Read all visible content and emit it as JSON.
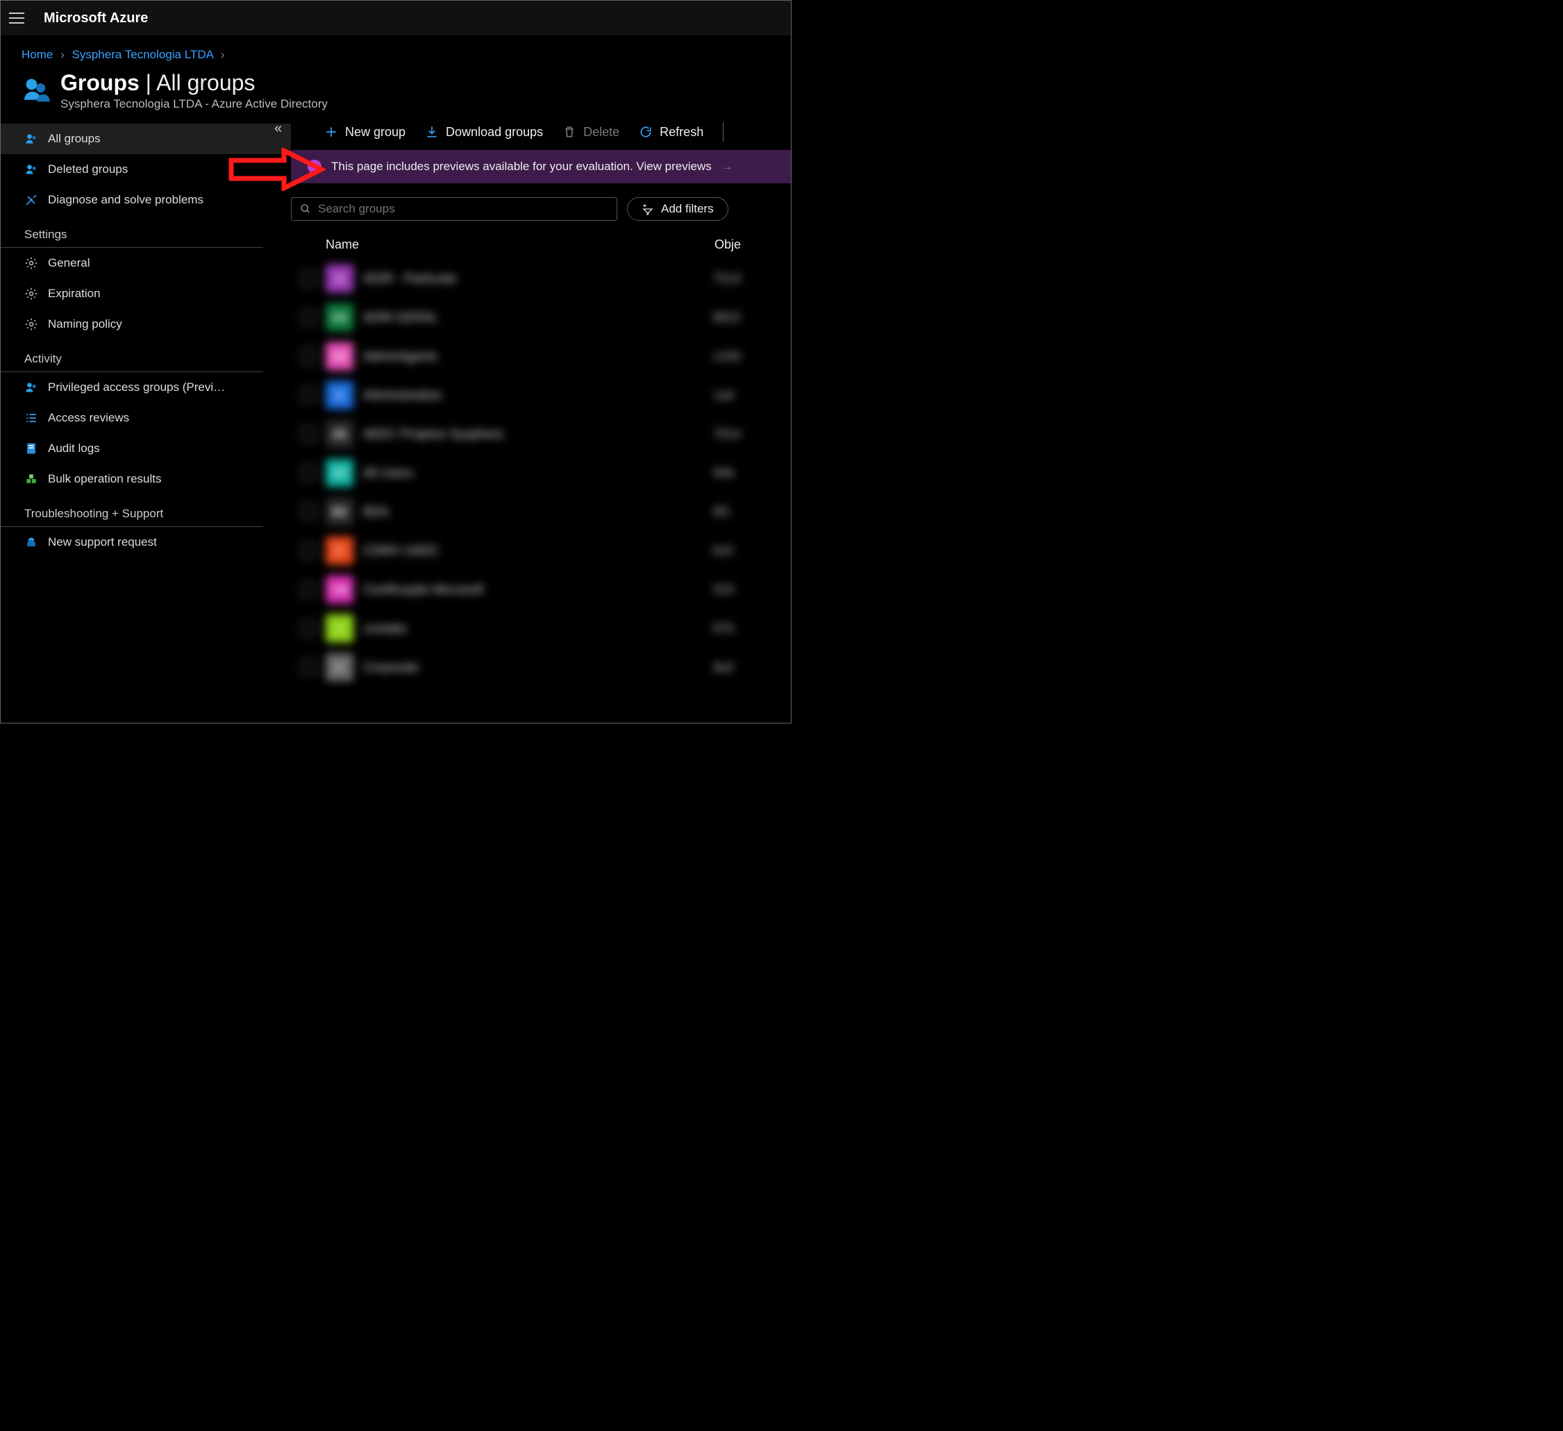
{
  "brand": "Microsoft Azure",
  "breadcrumb": {
    "home": "Home",
    "tenant": "Sysphera Tecnologia LTDA"
  },
  "title": {
    "main": "Groups",
    "section": "All groups",
    "subtitle": "Sysphera Tecnologia LTDA - Azure Active Directory"
  },
  "toolbar": {
    "new_group": "New group",
    "download": "Download groups",
    "delete": "Delete",
    "refresh": "Refresh"
  },
  "banner": {
    "text": "This page includes previews available for your evaluation. View previews"
  },
  "search": {
    "placeholder": "Search groups"
  },
  "filter_btn": "Add filters",
  "columns": {
    "name": "Name",
    "object": "Obje"
  },
  "sidebar": {
    "items": [
      {
        "label": "All groups",
        "icon": "people-icon",
        "active": true
      },
      {
        "label": "Deleted groups",
        "icon": "people-icon"
      },
      {
        "label": "Diagnose and solve problems",
        "icon": "tools-icon"
      }
    ],
    "headers": {
      "settings": "Settings",
      "activity": "Activity",
      "support": "Troubleshooting + Support"
    },
    "settings": [
      {
        "label": "General",
        "icon": "gear-icon"
      },
      {
        "label": "Expiration",
        "icon": "gear-icon"
      },
      {
        "label": "Naming policy",
        "icon": "gear-icon"
      }
    ],
    "activity": [
      {
        "label": "Privileged access groups (Previ…",
        "icon": "people-icon"
      },
      {
        "label": "Access reviews",
        "icon": "checklist-icon"
      },
      {
        "label": "Audit logs",
        "icon": "log-icon"
      },
      {
        "label": "Bulk operation results",
        "icon": "cubes-icon"
      }
    ],
    "support": [
      {
        "label": "New support request",
        "icon": "headset-icon"
      }
    ]
  },
  "rows": [
    {
      "initials": "A",
      "color": "#9b3db5",
      "name": "AD/R - Particular",
      "oid": "7514"
    },
    {
      "initials": "AG",
      "color": "#0f7a3e",
      "name": "ADW GERAL",
      "oid": "8622"
    },
    {
      "initials": "AA",
      "color": "#e64fb6",
      "name": "AdminAgents",
      "oid": "c24d"
    },
    {
      "initials": "A",
      "color": "#1e6fe0",
      "name": "Administrative",
      "oid": "1a4"
    },
    {
      "initials": "AE",
      "color": "#2a2a2a",
      "name": "AEEC Projetos Sysphera",
      "oid": "7014"
    },
    {
      "initials": "AU",
      "color": "#10b3a3",
      "name": "All Users",
      "oid": "94b"
    },
    {
      "initials": "BD",
      "color": "#2a2a2a",
      "name": "BDA",
      "oid": "6f1"
    },
    {
      "initials": "C",
      "color": "#e8491c",
      "name": "CDMV LWDC",
      "oid": "6c5"
    },
    {
      "initials": "CM",
      "color": "#d72fb0",
      "name": "Certificação Microsoft",
      "oid": "524"
    },
    {
      "initials": "c",
      "color": "#8fd31a",
      "name": "contabs",
      "oid": "67b"
    },
    {
      "initials": "C",
      "color": "#6a6a6a",
      "name": "Corporate",
      "oid": "9a2"
    }
  ]
}
